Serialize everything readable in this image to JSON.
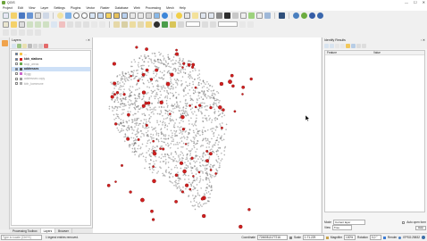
{
  "window": {
    "title": "QGIS",
    "controls": [
      "—",
      "☐",
      "✕"
    ]
  },
  "menu": [
    "Project",
    "Edit",
    "View",
    "Layer",
    "Settings",
    "Plugins",
    "Vector",
    "Raster",
    "Database",
    "Web",
    "Processing",
    "Mesh",
    "Help"
  ],
  "toolbar": {
    "scale_combo": "",
    "fill_combo": ""
  },
  "layers_panel": {
    "title": "Layers",
    "layers": [
      {
        "label": "...",
        "checked": true,
        "bold": false,
        "dim": false,
        "selected": false,
        "color": "#f7c64d"
      },
      {
        "label": "kbh_stations",
        "checked": true,
        "bold": true,
        "dim": false,
        "selected": false,
        "color": "#d11f1f"
      },
      {
        "label": "stop_areas",
        "checked": false,
        "bold": false,
        "dim": true,
        "selected": false,
        "color": "#6aa84f"
      },
      {
        "label": "addresses",
        "checked": true,
        "bold": true,
        "dim": false,
        "selected": true,
        "color": "#555555"
      },
      {
        "label": "Bygg",
        "checked": false,
        "bold": false,
        "dim": true,
        "selected": false,
        "color": "#cc66cc"
      },
      {
        "label": "addresses copy",
        "checked": false,
        "bold": false,
        "dim": true,
        "selected": false,
        "color": "#999999"
      },
      {
        "label": "kbh_kommune",
        "checked": false,
        "bold": false,
        "dim": true,
        "selected": false,
        "color": "#aaaaaa"
      }
    ]
  },
  "bottom_tabs": [
    "Processing Toolbox",
    "Layers",
    "Browser"
  ],
  "identify_panel": {
    "title": "Identify Results",
    "columns": [
      "Feature",
      "Value"
    ],
    "mode_label": "Mode",
    "mode_value": "Current layer",
    "auto_open_label": "Auto open form",
    "view_label": "View",
    "view_value": "Tree",
    "help_label": "Help"
  },
  "statusbar": {
    "locator_placeholder": "Type to locate (Ctrl+K)",
    "message": "1 legend entries removed.",
    "coordinate_label": "Coordinate",
    "coordinate_value": "724608,6177216",
    "scale_label": "Scale",
    "scale_value": "1:71.229",
    "magnifier_label": "Magnifier",
    "magnifier_value": "100%",
    "rotation_label": "Rotation",
    "rotation_value": "0,0 °",
    "render_label": "Render",
    "crs": "EPSG:25832"
  },
  "colors": {
    "accent": "#3a7bd5",
    "station": "#d11f1f",
    "address": "#555555"
  }
}
